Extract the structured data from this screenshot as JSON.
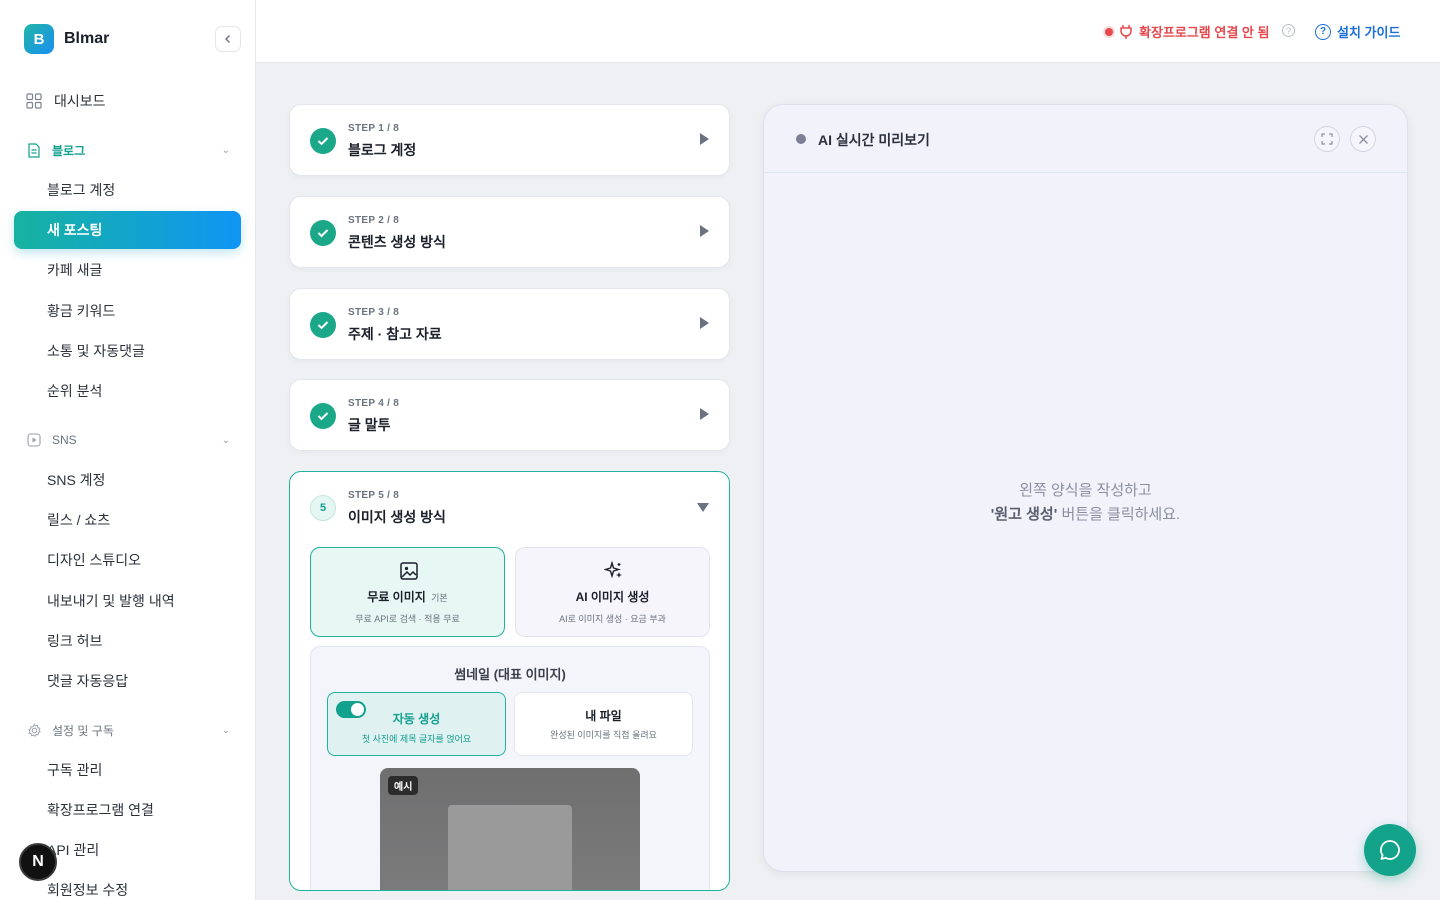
{
  "brand": {
    "logo_letter": "B",
    "name": "Blmar"
  },
  "sidebar": {
    "dashboard": "대시보드",
    "sections": {
      "blog": {
        "label": "블로그",
        "items": [
          "블로그 계정",
          "새 포스팅",
          "카페 새글",
          "황금 키워드",
          "소통 및 자동댓글",
          "순위 분석"
        ]
      },
      "sns": {
        "label": "SNS",
        "items": [
          "SNS 계정",
          "릴스 / 쇼츠",
          "디자인 스튜디오",
          "내보내기 및 발행 내역",
          "링크 허브",
          "댓글 자동응답"
        ]
      },
      "settings": {
        "label": "설정 및 구독",
        "items": [
          "구독 관리",
          "확장프로그램 연결",
          "API 관리",
          "회원정보 수정"
        ]
      }
    },
    "avatar_letter": "N"
  },
  "topbar": {
    "extension_status": "확장프로그램 연결 안 됨",
    "help_icon": "?",
    "guide_label": "설치 가이드"
  },
  "steps": [
    {
      "tag": "STEP 1 / 8",
      "title": "블로그 계정",
      "done": true
    },
    {
      "tag": "STEP 2 / 8",
      "title": "콘텐츠 생성 방식",
      "done": true
    },
    {
      "tag": "STEP 3 / 8",
      "title": "주제 · 참고 자료",
      "done": true
    },
    {
      "tag": "STEP 4 / 8",
      "title": "글 말투",
      "done": true
    },
    {
      "tag": "STEP 5 / 8",
      "title": "이미지 생성 방식",
      "number": "5",
      "open": true
    }
  ],
  "image_options": {
    "free": {
      "title": "무료 이미지",
      "sub": "기본",
      "desc": "무료 API로 검색 · 적용 무료",
      "selected": true
    },
    "ai": {
      "title": "AI 이미지 생성",
      "desc": "AI로 이미지 생성 · 요금 부과"
    }
  },
  "thumbnail": {
    "heading": "썸네일 (대표 이미지)",
    "auto": {
      "title": "자동 생성",
      "desc": "첫 사진에 제목 글자를 얹어요",
      "toggle_on": true
    },
    "mine": {
      "title": "내 파일",
      "desc": "완성된 이미지를 직접 올려요"
    },
    "example_badge": "예시"
  },
  "preview": {
    "title": "AI 실시간 미리보기",
    "msg_line1": "왼쪽 양식을 작성하고",
    "msg_bold": "'원고 생성'",
    "msg_line2_rest": " 버튼을 클릭하세요."
  },
  "colors": {
    "accent": "#12a08f",
    "accent_blue": "#0f95f5",
    "danger": "#e5484d",
    "link": "#1a6fd9"
  },
  "icons": {
    "dashboard": "grid-icon",
    "blog": "document-icon",
    "sns": "play-icon",
    "settings": "gear-icon",
    "extension": "plug-icon",
    "free_image": "image-icon",
    "ai_image": "sparkles-icon",
    "chat": "chat-bubble-icon"
  }
}
